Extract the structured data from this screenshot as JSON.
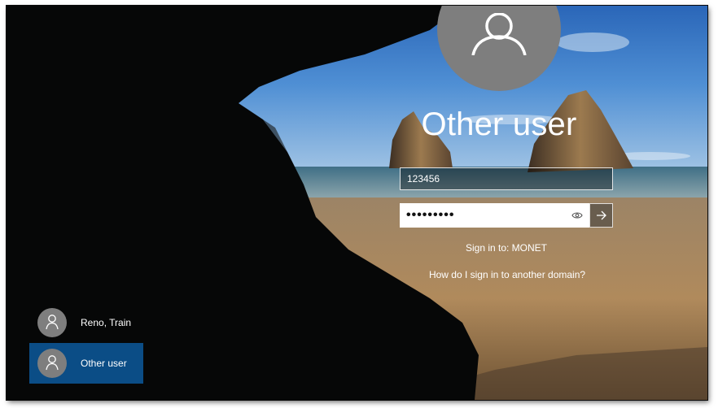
{
  "login": {
    "title": "Other user",
    "username_value": "123456",
    "password_display": "•••••••••",
    "sign_in_to": "Sign in to: MONET",
    "help_link": "How do I sign in to another domain?",
    "reveal_icon": "eye-icon",
    "submit_icon": "arrow-right-icon",
    "avatar_icon": "person-icon"
  },
  "user_list": {
    "items": [
      {
        "label": "Reno, Train",
        "selected": false
      },
      {
        "label": "Other user",
        "selected": true
      }
    ]
  },
  "colors": {
    "selected_tile": "#0b4d86",
    "avatar": "#7e7e7e",
    "text": "#ffffff"
  }
}
